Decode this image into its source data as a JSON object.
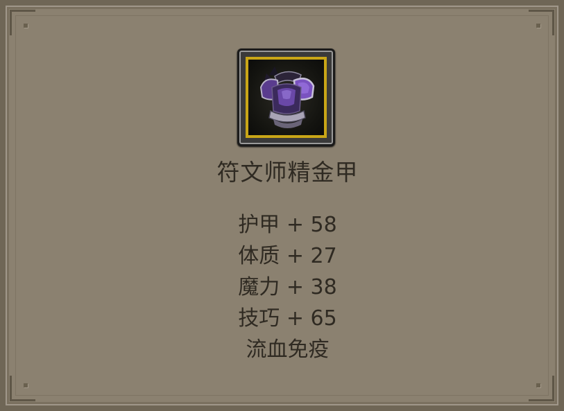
{
  "item": {
    "name": "符文师精金甲",
    "icon": "purple-armor-icon",
    "frame_color": "#c9a617"
  },
  "stats": [
    "护甲 + 58",
    "体质 + 27",
    "魔力 + 38",
    "技巧 + 65",
    "流血免疫"
  ],
  "colors": {
    "panel": "#8b8170",
    "text": "#2f2a22",
    "armor": "#7a52c0"
  }
}
